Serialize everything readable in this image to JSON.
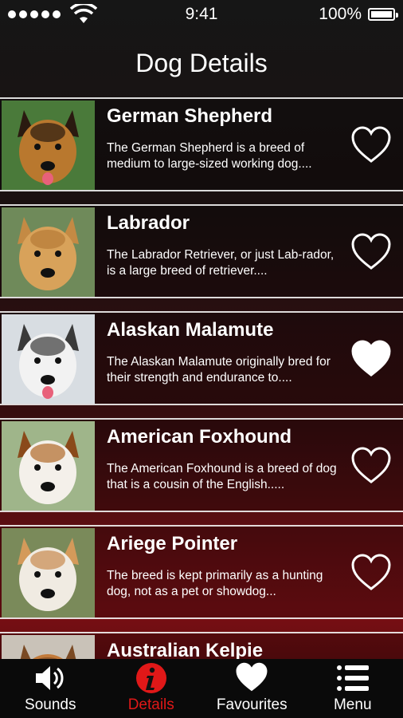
{
  "status_bar": {
    "time": "9:41",
    "battery": "100%",
    "battery_level": 1.0
  },
  "header": {
    "title": "Dog Details"
  },
  "breeds": [
    {
      "name": "German Shepherd",
      "description": "The German Shepherd is a breed of medium to large-sized working dog....",
      "favourite": false
    },
    {
      "name": "Labrador",
      "description": "The Labrador Retriever, or just Lab-rador, is a large breed of retriever....",
      "favourite": false
    },
    {
      "name": "Alaskan Malamute",
      "description": "The Alaskan Malamute originally bred for their strength and endurance to....",
      "favourite": true
    },
    {
      "name": "American Foxhound",
      "description": "The American Foxhound is a breed of dog that is a cousin of the English.....",
      "favourite": false
    },
    {
      "name": "Ariege Pointer",
      "description": "The breed is kept primarily as a hunting dog, not as a pet or showdog...",
      "favourite": false
    },
    {
      "name": "Australian Kelpie",
      "description": "",
      "favourite": false
    }
  ],
  "tabs": [
    {
      "label": "Sounds",
      "icon": "speaker-icon",
      "active": false
    },
    {
      "label": "Details",
      "icon": "info-icon",
      "active": true
    },
    {
      "label": "Favourites",
      "icon": "heart-icon",
      "active": false
    },
    {
      "label": "Menu",
      "icon": "menu-icon",
      "active": false
    }
  ],
  "colors": {
    "accent": "#e01818",
    "text": "#ffffff",
    "tab_bar": "#0a0a0a"
  }
}
